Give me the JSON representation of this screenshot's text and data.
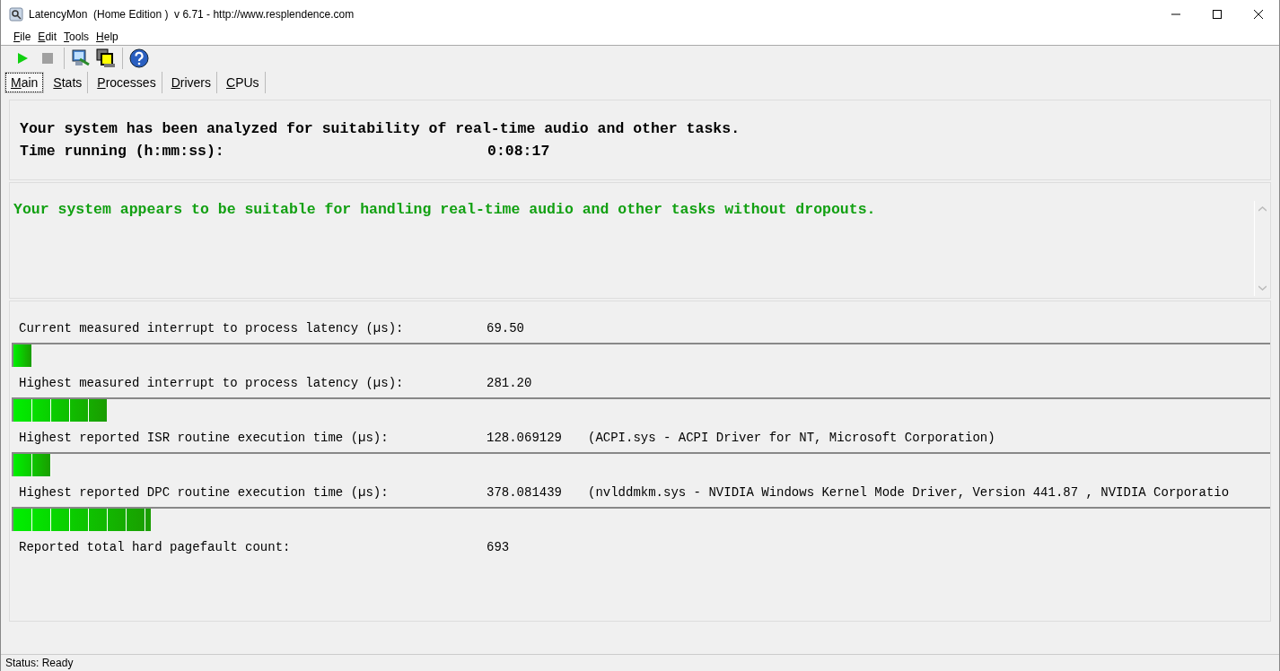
{
  "window": {
    "title": "LatencyMon  (Home Edition )  v 6.71 - http://www.resplendence.com"
  },
  "menu": [
    "File",
    "Edit",
    "Tools",
    "Help"
  ],
  "tabs": [
    {
      "label": "Main",
      "selected": true
    },
    {
      "label": "Stats",
      "selected": false
    },
    {
      "label": "Processes",
      "selected": false
    },
    {
      "label": "Drivers",
      "selected": false
    },
    {
      "label": "CPUs",
      "selected": false
    }
  ],
  "summary": {
    "headline": "Your system has been analyzed for suitability of real-time audio and other tasks.",
    "time_label": "Time running (h:mm:ss):",
    "time_value": "0:08:17"
  },
  "verdict": "Your system appears to be suitable for handling real-time audio and other tasks without dropouts.",
  "metrics": [
    {
      "label": "Current measured interrupt to process latency (µs):",
      "value": "69.50",
      "level": 0.014
    },
    {
      "label": "Highest measured interrupt to process latency (µs):",
      "value": "281.20",
      "level": 0.074
    },
    {
      "label": "Highest reported ISR routine execution time (µs):",
      "value": "128.069129",
      "detail": "(ACPI.sys - ACPI Driver for NT, Microsoft Corporation)",
      "level": 0.03
    },
    {
      "label": "Highest reported DPC routine execution time (µs):",
      "value": "378.081439",
      "detail": "(nvlddmkm.sys - NVIDIA Windows Kernel Mode Driver, Version 441.87 , NVIDIA Corporatio",
      "level": 0.109
    },
    {
      "label": "Reported total hard pagefault count:",
      "value": "693"
    }
  ],
  "status_bar": "Status: Ready"
}
